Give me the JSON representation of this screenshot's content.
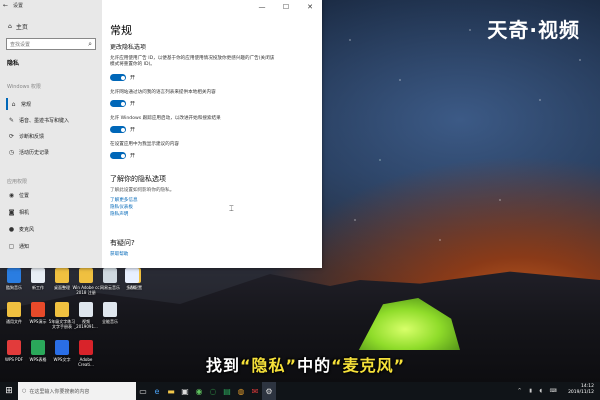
{
  "window": {
    "title": "设置",
    "home": "主页",
    "search_placeholder": "查找设置",
    "section": "隐私",
    "groups": {
      "windows_permissions": "Windows 权限",
      "app_permissions": "应用权限"
    },
    "nav_items": [
      {
        "label": "常规",
        "icon": "lock-icon",
        "active": true
      },
      {
        "label": "语音、墨迹书写和键入",
        "icon": "speech-icon",
        "active": false
      },
      {
        "label": "诊断和反馈",
        "icon": "feedback-icon",
        "active": false
      },
      {
        "label": "活动历史记录",
        "icon": "history-icon",
        "active": false
      },
      {
        "label": "位置",
        "icon": "location-icon",
        "active": false
      },
      {
        "label": "相机",
        "icon": "camera-icon",
        "active": false
      },
      {
        "label": "麦克风",
        "icon": "microphone-icon",
        "active": false
      },
      {
        "label": "通知",
        "icon": "notification-icon",
        "active": false
      }
    ]
  },
  "content": {
    "title": "常规",
    "section_title": "更改隐私选项",
    "options": [
      {
        "text": "允许应用使用广告 ID，以便基于你的应用使用情况投放你更感兴趣的广告(关闭该模式将重置你的 ID)。",
        "state": "开"
      },
      {
        "text": "允许网站通过访问我的语言列表来提供本地相关内容",
        "state": "开"
      },
      {
        "text": "允许 Windows 跟踪应用启动，以改进开始和搜索结果",
        "state": "开"
      },
      {
        "text": "在设置应用中为我显示建议的内容",
        "state": "开"
      }
    ],
    "know_title": "了解你的隐私选项",
    "know_desc": "了解此设置如何影响你的隐私。",
    "links": [
      "了解更多信息",
      "隐私仪表板",
      "隐私声明"
    ],
    "question_title": "有疑问?",
    "help_link": "获取帮助"
  },
  "desktop": {
    "watermark": "天奇·视频",
    "subtitle_parts": [
      "找到",
      "“隐私”",
      "中的",
      "“麦克风”"
    ],
    "icons": [
      {
        "label": "酷狗音乐",
        "color": "#2a7de1"
      },
      {
        "label": "新工作",
        "color": "#e8eef5"
      },
      {
        "label": "桌面整理",
        "color": "#f0c040"
      },
      {
        "label": "Win Adobe cc 2018 注册",
        "color": "#f0c040"
      },
      {
        "label": "网易云音乐",
        "color": "#cfd8e0"
      },
      {
        "label": "主题配置",
        "color": "#f0c040"
      },
      {
        "label": "SAKI",
        "color": "#e8f0ff"
      },
      {
        "label": "通用文件",
        "color": "#f0c040"
      },
      {
        "label": "WPS演示",
        "color": "#e84a2a"
      },
      {
        "label": "5年级文字练习 文字手册表",
        "color": "#f0c040"
      },
      {
        "label": "视频_2019091...",
        "color": "#dfe6ee"
      },
      {
        "label": "全能音乐",
        "color": "#dfe6ee"
      },
      {
        "label": "WPS PDF",
        "color": "#e23b3b"
      },
      {
        "label": "WPS表格",
        "color": "#2aa85a"
      },
      {
        "label": "WPS文字",
        "color": "#2a6ee6"
      },
      {
        "label": "Adobe Creati...",
        "color": "#d8232a"
      }
    ]
  },
  "taskbar": {
    "search_placeholder": "在这里输入你要搜索的内容",
    "time": "14:12",
    "date": "2019/11/12"
  }
}
